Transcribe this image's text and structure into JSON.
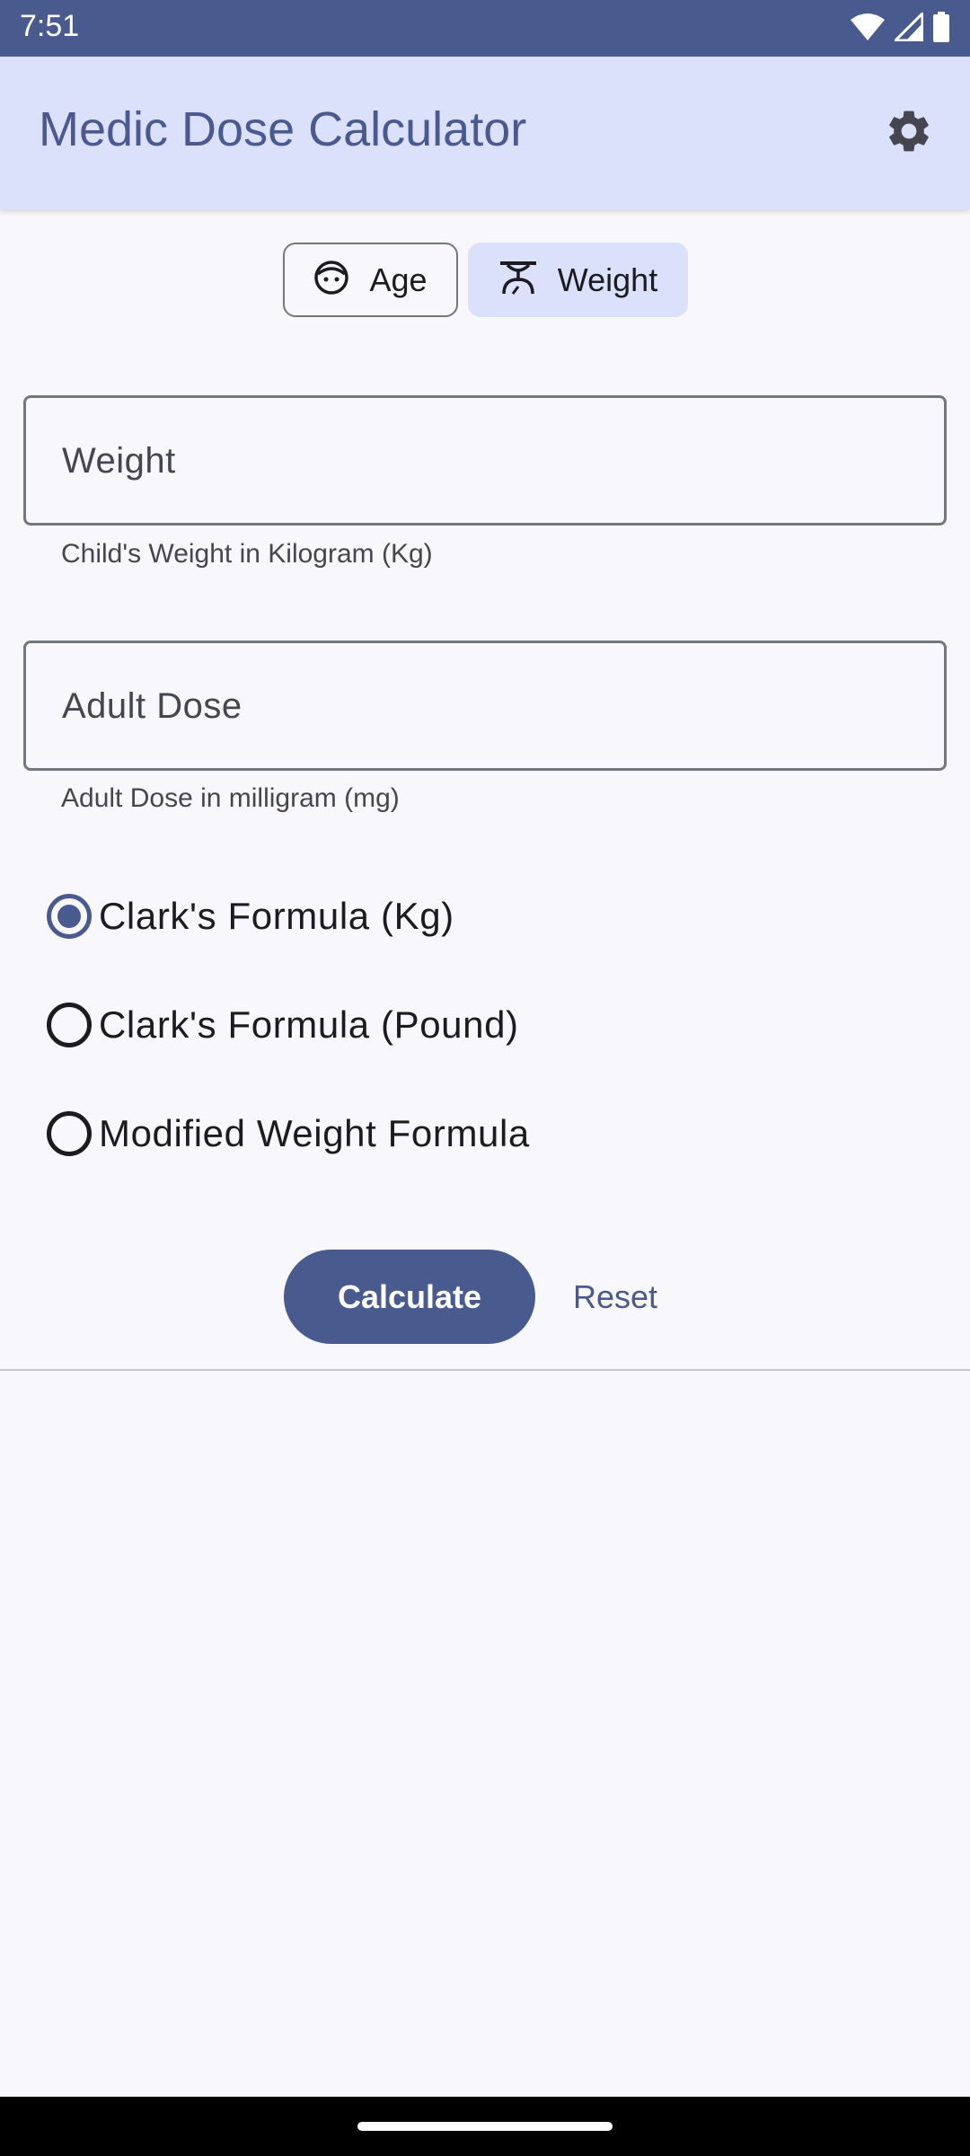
{
  "status_bar": {
    "time": "7:51",
    "icons": [
      "wifi-icon",
      "signal-icon",
      "battery-icon"
    ]
  },
  "app_bar": {
    "title": "Medic Dose Calculator",
    "settings_icon": "gear-icon"
  },
  "mode_toggle": {
    "options": [
      {
        "label": "Age",
        "icon": "face-icon",
        "selected": false
      },
      {
        "label": "Weight",
        "icon": "scale-icon",
        "selected": true
      }
    ]
  },
  "form": {
    "weight_field": {
      "label": "Weight",
      "value": "",
      "helper": "Child's Weight in Kilogram (Kg)"
    },
    "dose_field": {
      "label": "Adult Dose",
      "value": "",
      "helper": "Adult Dose in milligram (mg)"
    },
    "formulas": [
      {
        "label": "Clark's Formula (Kg)",
        "selected": true
      },
      {
        "label": "Clark's Formula (Pound)",
        "selected": false
      },
      {
        "label": "Modified Weight Formula",
        "selected": false
      }
    ]
  },
  "actions": {
    "calculate_label": "Calculate",
    "reset_label": "Reset"
  },
  "colors": {
    "primary": "#495a8f",
    "app_bar_bg": "#dce1fb",
    "background": "#f8f7fc",
    "outline": "#75777f"
  }
}
